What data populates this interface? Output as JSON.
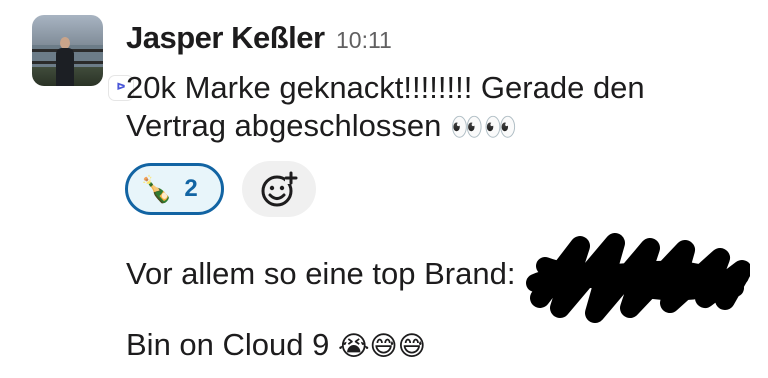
{
  "message": {
    "sender": "Jasper Keßler",
    "time": "10:11",
    "lines": [
      "20k Marke geknackt!!!!!!!! Gerade den",
      "Vertrag abgeschlossen",
      "Vor allem so eine top Brand:",
      "Bin on Cloud 9"
    ],
    "line2_emojis": "👀👀",
    "line4_emojis": "😭😅😅",
    "reaction": {
      "emoji": "🍾",
      "count": "2",
      "icon": "champagne-bottle"
    },
    "add_reaction_icon": "add-emoji-icon",
    "accent_color": "#1264a3"
  }
}
